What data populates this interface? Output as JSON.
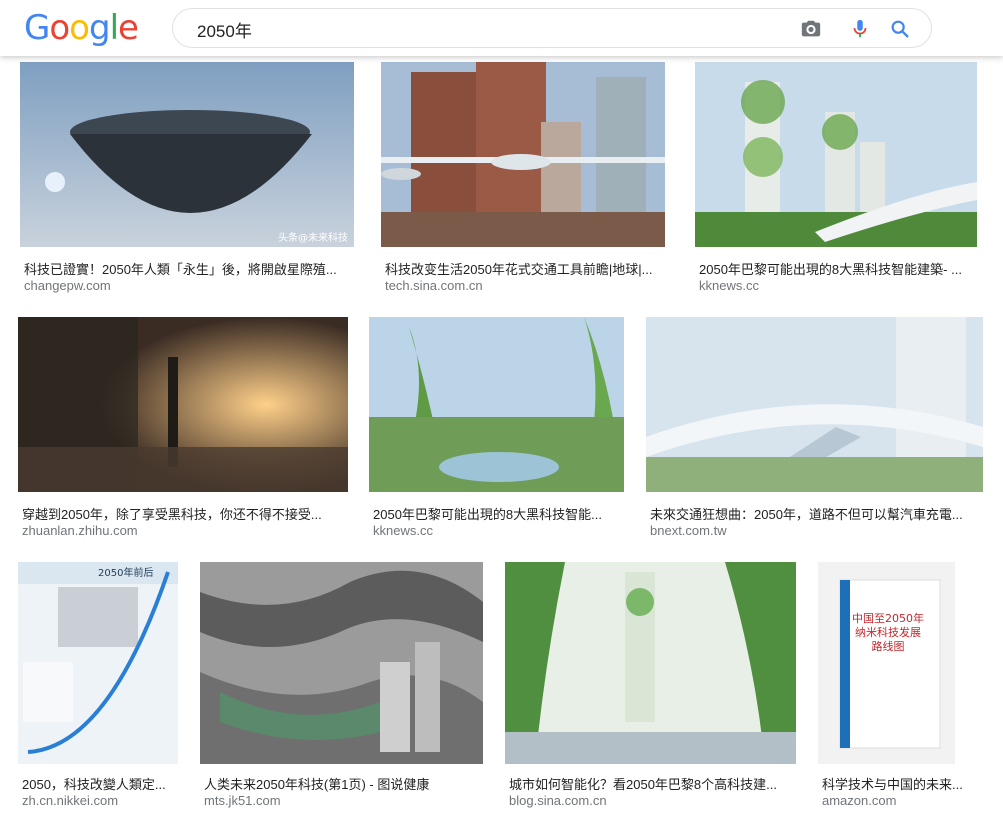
{
  "header": {
    "logo_letters": [
      "G",
      "o",
      "o",
      "g",
      "l",
      "e"
    ],
    "logo_colors": [
      "#4285F4",
      "#EA4335",
      "#FBBC05",
      "#4285F4",
      "#34A853",
      "#EA4335"
    ],
    "search_value": "2050年",
    "icons": [
      "camera-icon",
      "microphone-icon",
      "search-icon"
    ]
  },
  "results": [
    {
      "caption": "科技已證實！2050年人類「永生」後，將開啟星際殖...",
      "source": "changepw.com"
    },
    {
      "caption": "科技改变生活2050年花式交通工具前瞻|地球|...",
      "source": "tech.sina.com.cn"
    },
    {
      "caption": "2050年巴黎可能出現的8大黑科技智能建築- ...",
      "source": "kknews.cc"
    },
    {
      "caption": "穿越到2050年，除了享受黑科技，你还不得不接受...",
      "source": "zhuanlan.zhihu.com"
    },
    {
      "caption": "2050年巴黎可能出現的8大黑科技智能...",
      "source": "kknews.cc"
    },
    {
      "caption": "未來交通狂想曲：2050年，道路不但可以幫汽車充電...",
      "source": "bnext.com.tw"
    },
    {
      "caption": "2050，科技改變人類定...",
      "source": "zh.cn.nikkei.com"
    },
    {
      "caption": "人类未来2050年科技(第1页) - 图说健康",
      "source": "mts.jk51.com"
    },
    {
      "caption": "城市如何智能化？看2050年巴黎8个高科技建...",
      "source": "blog.sina.com.cn"
    },
    {
      "caption": "科学技术与中国的未来...",
      "source": "amazon.com"
    }
  ],
  "image_text": {
    "img1_watermark": "头条@未来科技",
    "img7_header": "2050年前后",
    "img10_title_line1": "中国至2050年",
    "img10_title_line2": "纳米科技发展",
    "img10_title_line3": "路线图"
  },
  "colors": {
    "source_gray": "#70757a",
    "blue_icon": "#4285F4",
    "mic_red": "#EA4335"
  }
}
